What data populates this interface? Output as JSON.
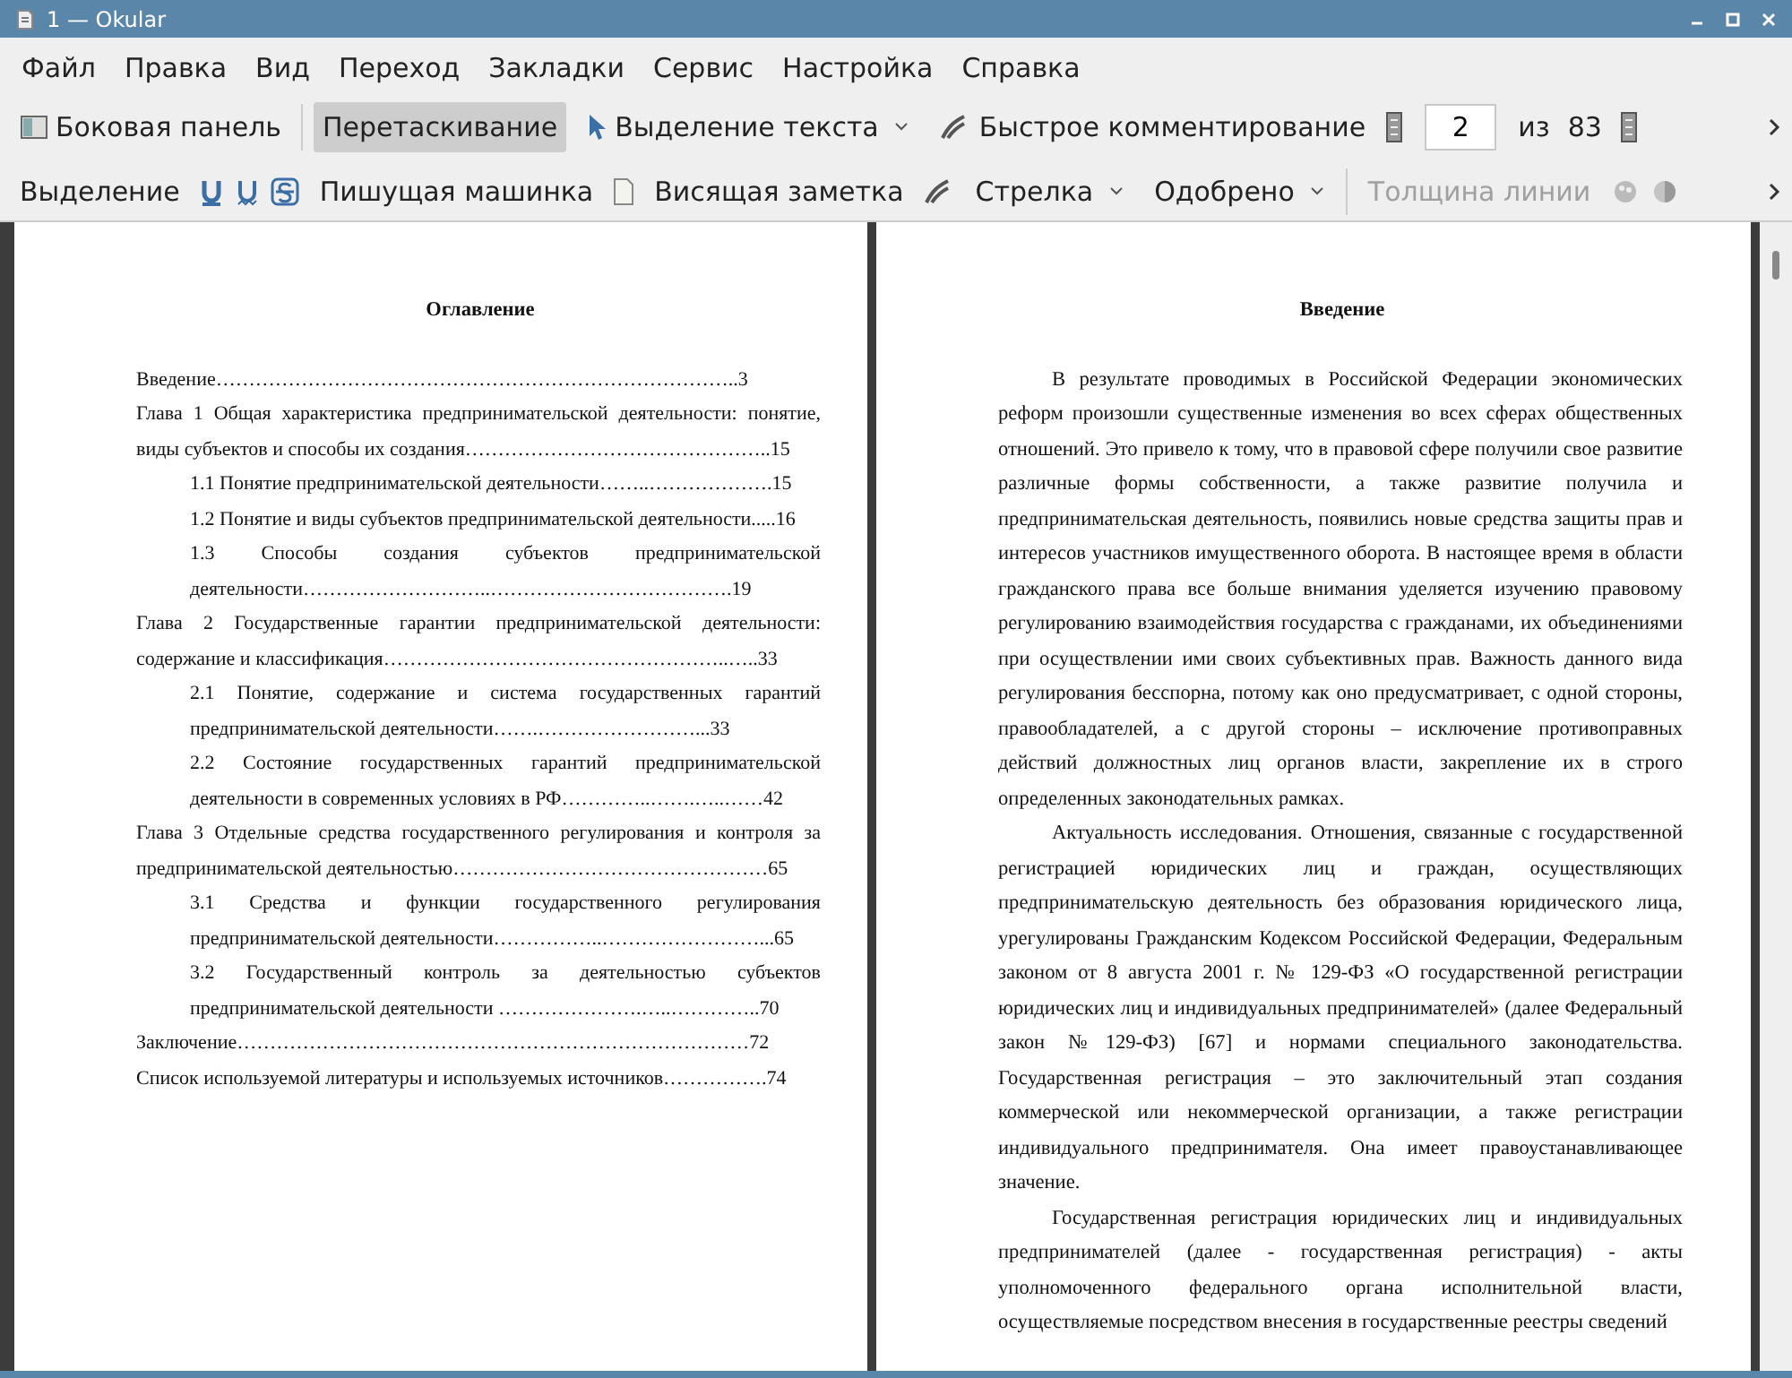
{
  "window": {
    "title": "1 — Okular"
  },
  "menu": [
    "Файл",
    "Правка",
    "Вид",
    "Переход",
    "Закладки",
    "Сервис",
    "Настройка",
    "Справка"
  ],
  "toolbar": {
    "sidebar": {
      "label": "Боковая панель"
    },
    "tools": [
      {
        "label": "Перетаскивание",
        "selected": true,
        "kind": "plain"
      },
      {
        "label": "Выделение текста",
        "selected": false,
        "kind": "dropdown"
      },
      {
        "label": "Быстрое комментирование",
        "selected": false,
        "kind": "annotate"
      }
    ],
    "page": {
      "current": "2",
      "separator": "из",
      "total": "83"
    }
  },
  "annotation_bar": {
    "highlight": "Выделение",
    "typewriter": "Пишущая машинка",
    "note": "Висящая заметка",
    "arrow": "Стрелка",
    "stamp": "Одобрено",
    "line_width": {
      "label": "Толщина линии",
      "disabled": true
    }
  },
  "pages": [
    {
      "title": "Оглавление",
      "kind": "toc",
      "entries": [
        {
          "kind": "chapter",
          "text": "Введение……………………………………………………………………..3"
        },
        {
          "kind": "chapter",
          "text": "Глава 1 Общая характеристика предпринимательской деятельности: понятие, виды субъектов и способы их создания………………………………………..15"
        },
        {
          "kind": "section",
          "text": "1.1 Понятие предпринимательской деятельности……..……………….15"
        },
        {
          "kind": "section",
          "text": "1.2 Понятие и виды субъектов предпринимательской деятельности.....16"
        },
        {
          "kind": "section",
          "text": "1.3 Способы создания субъектов предпринимательской деятельности………………………..……………………………….19"
        },
        {
          "kind": "chapter",
          "text": "Глава 2 Государственные гарантии предпринимательской деятельности: содержание и классификация……………………………………………..…..33"
        },
        {
          "kind": "section",
          "text": "2.1 Понятие, содержание и система государственных гарантий предпринимательской деятельности…….……………………...33"
        },
        {
          "kind": "section",
          "text": "2.2 Состояние государственных гарантий предпринимательской деятельности в современных условиях в РФ…………..…….…..……42"
        },
        {
          "kind": "chapter",
          "text": "Глава 3 Отдельные средства государственного регулирования и контроля за предпринимательской деятельностью…………………………………………65"
        },
        {
          "kind": "section",
          "text": "3.1 Средства и функции государственного регулирования предпринимательской деятельности……………..……………………...65"
        },
        {
          "kind": "section",
          "text": "3.2 Государственный контроль за деятельностью субъектов предпринимательской деятельности ………………….…..…………..70"
        },
        {
          "kind": "chapter",
          "text": "Заключение……………………………………………………………………72"
        },
        {
          "kind": "chapter",
          "text": "Список используемой литературы и используемых источников…………….74"
        }
      ]
    },
    {
      "title": "Введение",
      "kind": "text",
      "paragraphs": [
        "В результате проводимых в Российской Федерации экономических реформ произошли существенные изменения во всех сферах общественных отношений. Это привело к тому, что в правовой сфере получили свое развитие различные формы собственности, а также развитие получила и предпринимательская деятельность, появились новые средства защиты прав и интересов участников имущественного оборота. В настоящее время в области гражданского права все больше внимания уделяется изучению правовому регулированию взаимодействия государства с гражданами, их объединениями при осуществлении ими своих субъективных прав. Важность данного вида регулирования бесспорна, потому как оно предусматривает, с одной стороны, правообладателей, а с другой стороны – исключение противоправных действий должностных лиц органов власти, закрепление их в строго определенных законодательных рамках.",
        "Актуальность исследования. Отношения, связанные с государственной регистрацией юридических лиц и граждан, осуществляющих предпринимательскую деятельность без образования юридического лица, урегулированы Гражданским Кодексом Российской Федерации, Федеральным законом от 8 августа 2001 г. № 129-ФЗ «О государственной регистрации юридических лиц и индивидуальных предпринимателей» (далее Федеральный закон №129-ФЗ) [67] и нормами специального законодательства. Государственная регистрация – это заключительный этап создания коммерческой или некоммерческой организации, а также регистрации индивидуального предпринимателя. Она имеет правоустанавливающее значение.",
        "Государственная регистрация юридических лиц и индивидуальных предпринимателей (далее - государственная регистрация) - акты уполномоченного федерального органа исполнительной власти, осуществляемые посредством внесения в государственные реестры сведений"
      ]
    }
  ]
}
